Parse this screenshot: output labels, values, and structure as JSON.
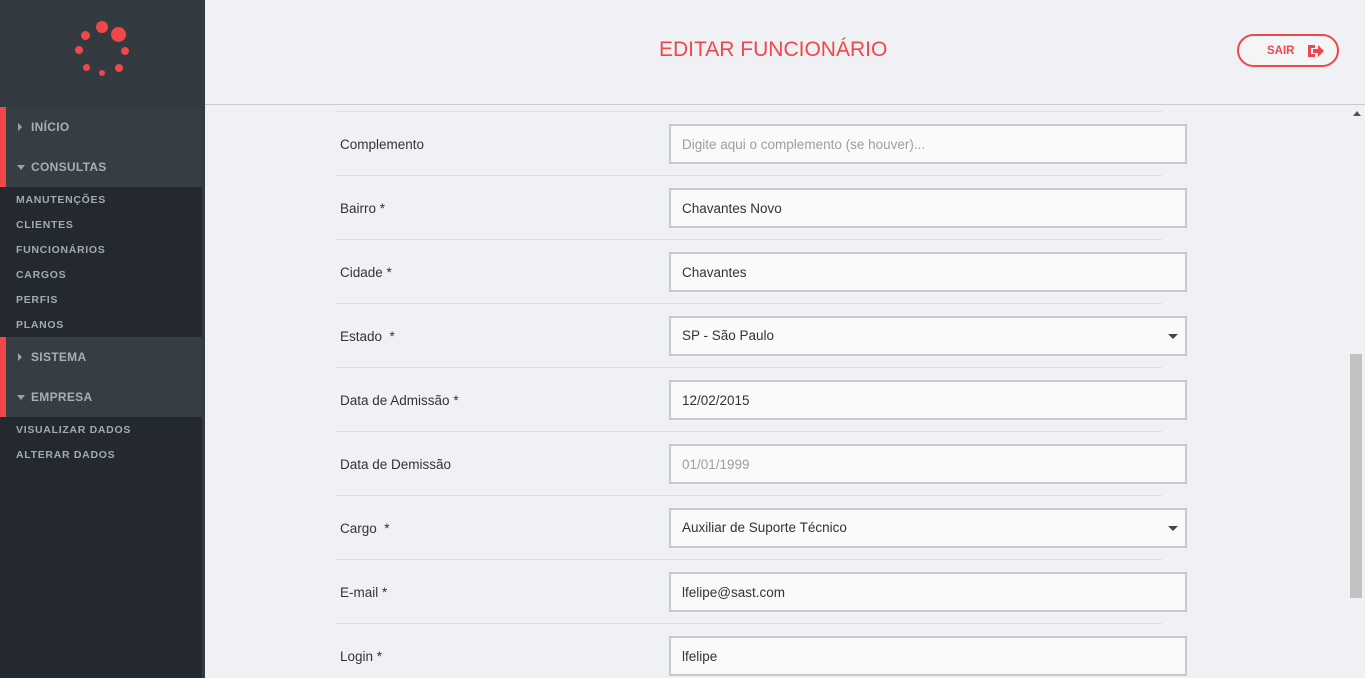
{
  "sidebar": {
    "groups": [
      {
        "label": "INÍCIO",
        "expanded": false
      },
      {
        "label": "CONSULTAS",
        "expanded": true
      },
      {
        "label": "SISTEMA",
        "expanded": false
      },
      {
        "label": "EMPRESA",
        "expanded": true
      }
    ],
    "consultas_items": [
      "MANUTENÇÕES",
      "CLIENTES",
      "FUNCIONÁRIOS",
      "CARGOS",
      "PERFIS",
      "PLANOS"
    ],
    "empresa_items": [
      "VISUALIZAR DADOS",
      "ALTERAR DADOS"
    ]
  },
  "header": {
    "title": "EDITAR FUNCIONÁRIO",
    "exit_label": "SAIR"
  },
  "form": {
    "complemento": {
      "label": "Complemento",
      "value": "",
      "placeholder": "Digite aqui o complemento (se houver)..."
    },
    "bairro": {
      "label": "Bairro *",
      "value": "Chavantes Novo"
    },
    "cidade": {
      "label": "Cidade *",
      "value": "Chavantes"
    },
    "estado": {
      "label": "Estado  *",
      "value": "SP - São Paulo"
    },
    "data_admissao": {
      "label": "Data de Admissão *",
      "value": "12/02/2015"
    },
    "data_demissao": {
      "label": "Data de Demissão",
      "value": "",
      "placeholder": "01/01/1999"
    },
    "cargo": {
      "label": "Cargo  *",
      "value": "Auxiliar de Suporte Técnico"
    },
    "email": {
      "label": "E-mail *",
      "value": "lfelipe@sast.com"
    },
    "login": {
      "label": "Login *",
      "value": "lfelipe"
    }
  },
  "colors": {
    "accent": "#f0474a",
    "sidebar": "#23292e"
  },
  "icons": {
    "logo": "loading-dots-logo",
    "exit": "sign-out-icon"
  }
}
